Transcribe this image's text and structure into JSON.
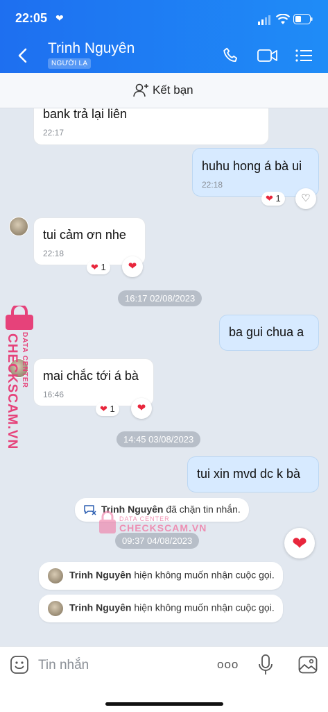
{
  "status_bar": {
    "time": "22:05"
  },
  "header": {
    "contact_name": "Trinh Nguyên",
    "stranger_badge": "NGƯỜI LẠ"
  },
  "friend_bar": {
    "label": "Kết bạn"
  },
  "messages": [
    {
      "text": "bank trả lại liên",
      "time": "22:17"
    },
    {
      "text": "huhu hong á bà ui",
      "time": "22:18",
      "reaction_count": "1"
    },
    {
      "text": "tui cảm ơn nhe",
      "time": "22:18",
      "reaction_count": "1"
    },
    {
      "text": "ba gui chua a"
    },
    {
      "text": "mai chắc tới á bà",
      "time": "16:46",
      "reaction_count": "1"
    },
    {
      "text": "tui xin mvd dc k bà"
    }
  ],
  "dates": [
    "16:17 02/08/2023",
    "14:45 03/08/2023",
    "09:37 04/08/2023"
  ],
  "system_notices": [
    {
      "name": "Trinh Nguyên",
      "text": " đã chặn tin nhắn."
    },
    {
      "name": "Trinh Nguyên",
      "text": " hiện không muốn nhận cuộc gọi."
    },
    {
      "name": "Trinh Nguyên",
      "text": " hiện không muốn nhận cuộc gọi."
    }
  ],
  "composer": {
    "placeholder": "Tin nhắn",
    "more_glyph": "ooo"
  },
  "watermark": {
    "side_brand": "CHECKSCAM.VN",
    "side_sub": "DATA CENTER",
    "center_brand": "CHECKSCAM.VN",
    "center_sub": "DATA CENTER"
  },
  "colors": {
    "header_blue": "#1e7cf3",
    "outgoing_bubble": "#d7eaff",
    "heart_red": "#e8263c",
    "watermark_pink": "#e6427a"
  }
}
